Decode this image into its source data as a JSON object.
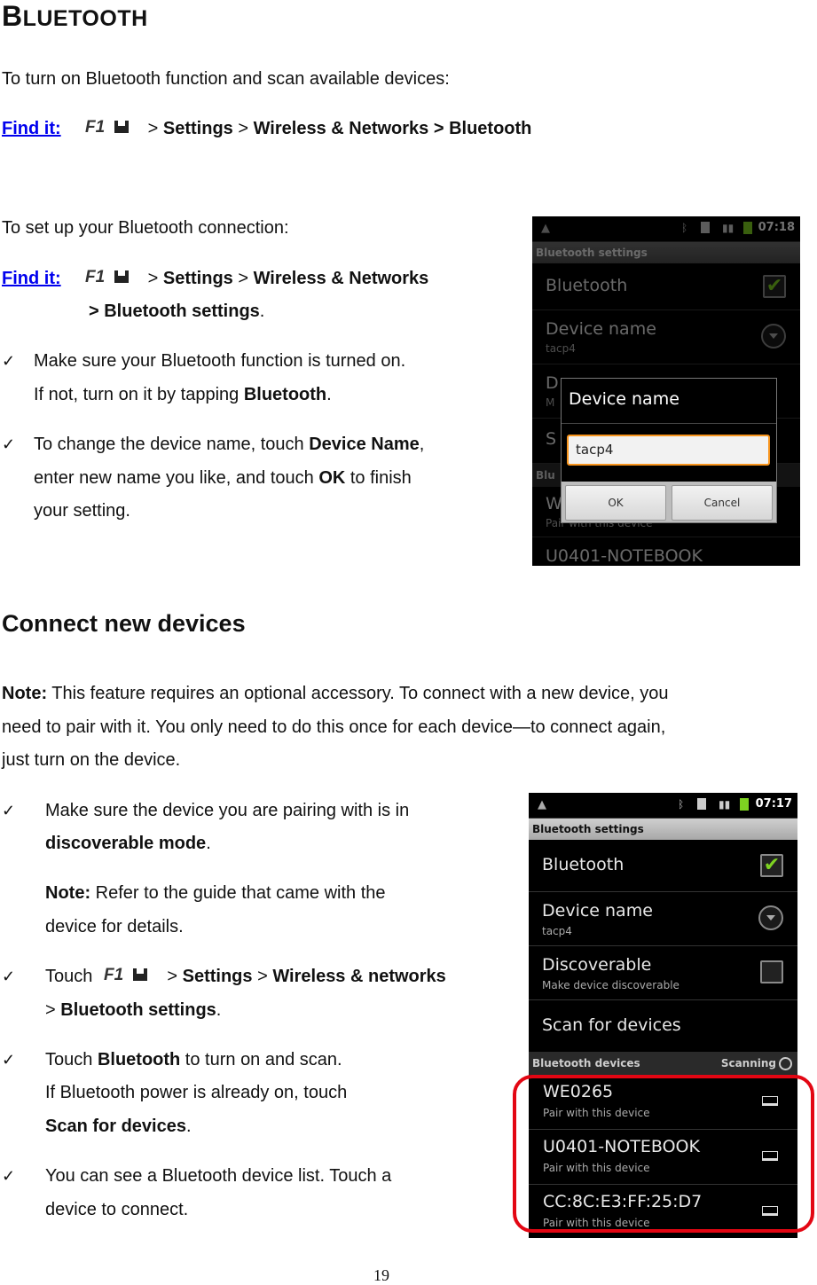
{
  "page": {
    "title_first": "B",
    "title_rest": "LUETOOTH",
    "intro1": "To turn on Bluetooth function and scan available devices:",
    "find_it_label": "Find it:",
    "key_icon": "F1-menu-key-icon",
    "path1": {
      "sep": ">",
      "settings": "Settings",
      "wireless": "Wireless & Networks > Bluetooth"
    },
    "intro2": "To set up your Bluetooth connection:",
    "path2": {
      "sep": ">",
      "settings": "Settings",
      "wireless": "Wireless & Networks",
      "line2": "> Bluetooth settings",
      "end": "."
    },
    "bullets1": [
      {
        "line1": "Make sure your Bluetooth function is turned on.",
        "line2_pre": "If not, turn on it by tapping ",
        "line2_bold": "Bluetooth",
        "line2_post": "."
      },
      {
        "line1_pre": "To change the device name, touch ",
        "line1_bold": "Device Name",
        "line1_post": ",",
        "line2_pre": "enter new name you like, and touch ",
        "line2_bold": "OK",
        "line2_post": " to finish",
        "line3": "your setting."
      }
    ],
    "section_heading": "Connect new devices",
    "note_label": "Note:",
    "note_text1": " This feature requires an optional accessory. To connect with a new device, you",
    "note_text2": "need to pair with it. You only need to do this once for each device—to connect again,",
    "note_text3": "just turn on the device.",
    "bullets2": [
      {
        "line1": "Make sure the device you are pairing with is in",
        "line2_bold": "discoverable mode",
        "line2_post": ".",
        "note_label": "Note:",
        "note1": " Refer to the guide that came with the",
        "note2": "device for details."
      },
      {
        "pre": "Touch",
        "sep": ">",
        "settings": "Settings",
        "wireless": "Wireless & networks",
        "line2_sep": "> ",
        "line2_bold": "Bluetooth settings",
        "line2_post": "."
      },
      {
        "pre": "Touch ",
        "bold": "Bluetooth",
        "post": " to turn on and scan.",
        "line2": "If Bluetooth power is already on, touch",
        "line3_bold": "Scan for devices",
        "line3_post": "."
      },
      {
        "line1": "You can see a Bluetooth device list. Touch a",
        "line2": "device to connect."
      }
    ],
    "page_number": "19",
    "check_mark": "✓"
  },
  "screen1": {
    "status_time": "07:18",
    "title": "Bluetooth settings",
    "rows": [
      {
        "label": "Bluetooth",
        "checked": true
      },
      {
        "label": "Device name",
        "sub": "tacp4"
      },
      {
        "label": "D",
        "sub": "M"
      },
      {
        "label": "S"
      }
    ],
    "section_partial": "Blu",
    "device_partial": "W",
    "device_sub": "Pair with this device",
    "next_partial": "U0401-NOTEBOOK",
    "dialog": {
      "title": "Device name",
      "value": "tacp4",
      "ok": "OK",
      "cancel": "Cancel"
    }
  },
  "screen2": {
    "status_time": "07:17",
    "title": "Bluetooth settings",
    "bluetooth": {
      "label": "Bluetooth",
      "checked": true,
      "check": "✔"
    },
    "device_name": {
      "label": "Device name",
      "sub": "tacp4"
    },
    "discoverable": {
      "label": "Discoverable",
      "sub": "Make device discoverable",
      "checked": false
    },
    "scan": {
      "label": "Scan for devices"
    },
    "devices_header": "Bluetooth devices",
    "scanning": "Scanning",
    "devices": [
      {
        "name": "WE0265",
        "sub": "Pair with this device"
      },
      {
        "name": "U0401-NOTEBOOK",
        "sub": "Pair with this device"
      },
      {
        "name": "CC:8C:E3:FF:25:D7",
        "sub": "Pair with this device"
      }
    ],
    "highlight_color": "#e30613"
  }
}
